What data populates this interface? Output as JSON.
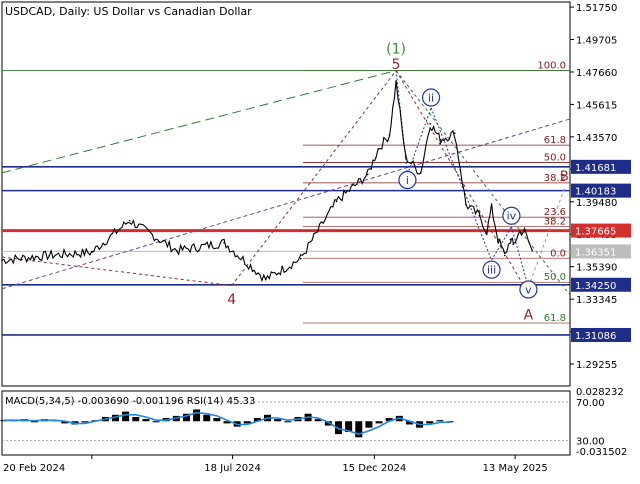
{
  "window": {
    "title": "USDCAD, Daily:  US Dollar vs Canadian Dollar",
    "indicator_label": "MACD(5,34,5) -0.003690 -0.001196 RSI(14) 45.33"
  },
  "colors": {
    "background": "#ffffff",
    "price_line": "#000000",
    "macd_hist": "#000000",
    "macd_signal": "#1e88e5",
    "support_line": "#1f2d8a",
    "resistance_line": "#d32f2f",
    "current_price_line": "#bdbdbd",
    "fib_line": "#8b1a1a",
    "fib_upper_line": "#c2a0a0",
    "trend_green": "#2e7d32",
    "channel_purple": "#6a3fb0",
    "wave_blue": "#1f35b0",
    "wave_red": "#a02a2a",
    "wave_label_green": "#3d8b3d",
    "label_dark": "#8b2a2a",
    "axis_text": "#000000"
  },
  "chart_data": {
    "type": "line",
    "title": "USDCAD, Daily:  US Dollar vs Canadian Dollar",
    "xlabel": "",
    "ylabel": "",
    "ylim": [
      1.2787,
      1.5207
    ],
    "x": [
      "2023-11-17",
      "2024-01-06",
      "2024-02-20",
      "2024-03-31",
      "2024-05-20",
      "2024-07-09",
      "2024-08-22",
      "2024-09-28",
      "2024-11-05",
      "2024-12-08",
      "2024-12-19",
      "2024-12-31",
      "2025-01-07",
      "2025-01-17",
      "2025-02-02",
      "2025-02-12",
      "2025-02-23",
      "2025-03-10",
      "2025-03-22",
      "2025-04-05",
      "2025-04-13",
      "2025-04-18",
      "2025-04-25",
      "2025-05-02",
      "2025-05-08",
      "2025-05-11",
      "2025-05-18",
      "2025-05-23",
      "2025-05-31"
    ],
    "series": [
      {
        "values": [
          1.358,
          1.361,
          1.363,
          1.383,
          1.364,
          1.369,
          1.346,
          1.359,
          1.395,
          1.412,
          1.428,
          1.437,
          1.47,
          1.423,
          1.413,
          1.444,
          1.434,
          1.438,
          1.393,
          1.386,
          1.376,
          1.391,
          1.371,
          1.361,
          1.371,
          1.368,
          1.376,
          1.376,
          1.364
        ]
      }
    ],
    "x_ticks": [
      "20 Feb 2024",
      "18 Jul 2024",
      "15 Dec 2024",
      "13 May 2025"
    ],
    "y_ticks": [
      "1.51750",
      "1.49705",
      "1.47660",
      "1.45615",
      "1.43570",
      "1.41525",
      "1.39480",
      "1.37435",
      "1.35390",
      "1.33345",
      "1.31300",
      "1.29255"
    ],
    "price_levels": [
      {
        "label": "1.41681",
        "value": 1.41681,
        "role": "support_blue"
      },
      {
        "label": "1.40183",
        "value": 1.40183,
        "role": "support_blue"
      },
      {
        "label": "1.37665",
        "value": 1.37665,
        "role": "resistance_red"
      },
      {
        "label": "1.36351",
        "value": 1.36351,
        "role": "current_price"
      },
      {
        "label": "1.34250",
        "value": 1.3425,
        "role": "support_blue"
      },
      {
        "label": "1.31086",
        "value": 1.31086,
        "role": "support_blue"
      }
    ],
    "fib_upper": [
      {
        "label": "100.0",
        "value": 1.4775
      },
      {
        "label": "61.8",
        "value": 1.4305
      },
      {
        "label": "50.0",
        "value": 1.4195
      },
      {
        "label": "38.2",
        "value": 1.4067
      }
    ],
    "fib_lower": [
      {
        "label": "38.2",
        "value": 1.3792
      },
      {
        "label": "23.6",
        "value": 1.3851
      },
      {
        "label": "0.0",
        "value": 1.3592
      },
      {
        "label": "50.0",
        "value": 1.3441
      },
      {
        "label": "61.8",
        "value": 1.3184
      }
    ],
    "wave_labels": [
      {
        "text": "(1)",
        "x": "2025-01-07",
        "y": 1.4915,
        "style": "green_paren"
      },
      {
        "text": "5",
        "x": "2025-01-07",
        "y": 1.4815,
        "style": "red"
      },
      {
        "text": "4",
        "x": "2024-07-17",
        "y": 1.3335,
        "style": "red"
      },
      {
        "text": "i",
        "x": "2025-01-19",
        "y": 1.4085,
        "style": "circle"
      },
      {
        "text": "ii",
        "x": "2025-02-13",
        "y": 1.4605,
        "style": "circle"
      },
      {
        "text": "iii",
        "x": "2025-04-18",
        "y": 1.352,
        "style": "circle"
      },
      {
        "text": "iv",
        "x": "2025-05-09",
        "y": 1.386,
        "style": "circle"
      },
      {
        "text": "v",
        "x": "2025-05-27",
        "y": 1.3395,
        "style": "circle"
      },
      {
        "text": "A",
        "x": "2025-05-27",
        "y": 1.3238,
        "style": "red"
      },
      {
        "text": "B",
        "x": "2025-07-04",
        "y": 1.4115,
        "style": "red_partial"
      }
    ],
    "indicator": {
      "name": "MACD(5,34,5) RSI(14)",
      "macd_main": -0.00369,
      "macd_signal": -0.001196,
      "rsi": 45.33,
      "y_ticks": [
        "0.028232",
        "70.00",
        "30.00",
        "-0.031502"
      ],
      "histogram": [
        0.001,
        0.001,
        0.002,
        -0.001,
        0.002,
        0.001,
        -0.002,
        -0.003,
        -0.001,
        0.001,
        0.004,
        0.006,
        0.009,
        0.004,
        0.002,
        -0.001,
        0.003,
        0.005,
        0.007,
        0.011,
        0.006,
        0.003,
        -0.002,
        -0.005,
        -0.002,
        0.003,
        0.006,
        0.002,
        -0.001,
        0.004,
        0.007,
        0.002,
        -0.004,
        -0.012,
        -0.01,
        -0.015,
        -0.006,
        -0.002,
        0.003,
        0.005,
        -0.003,
        -0.006,
        -0.002,
        0.001,
        -0.001
      ],
      "signal": [
        0.001,
        0.001,
        0.001,
        0.0005,
        0.001,
        0.001,
        0.0,
        -0.002,
        -0.002,
        0.0,
        0.002,
        0.004,
        0.006,
        0.006,
        0.004,
        0.001,
        0.001,
        0.003,
        0.005,
        0.008,
        0.007,
        0.005,
        0.001,
        -0.003,
        -0.003,
        0.0,
        0.003,
        0.003,
        0.001,
        0.002,
        0.004,
        0.003,
        -0.001,
        -0.007,
        -0.009,
        -0.012,
        -0.009,
        -0.005,
        0.0,
        0.003,
        0.0,
        -0.003,
        -0.003,
        -0.001,
        -0.001
      ]
    }
  }
}
